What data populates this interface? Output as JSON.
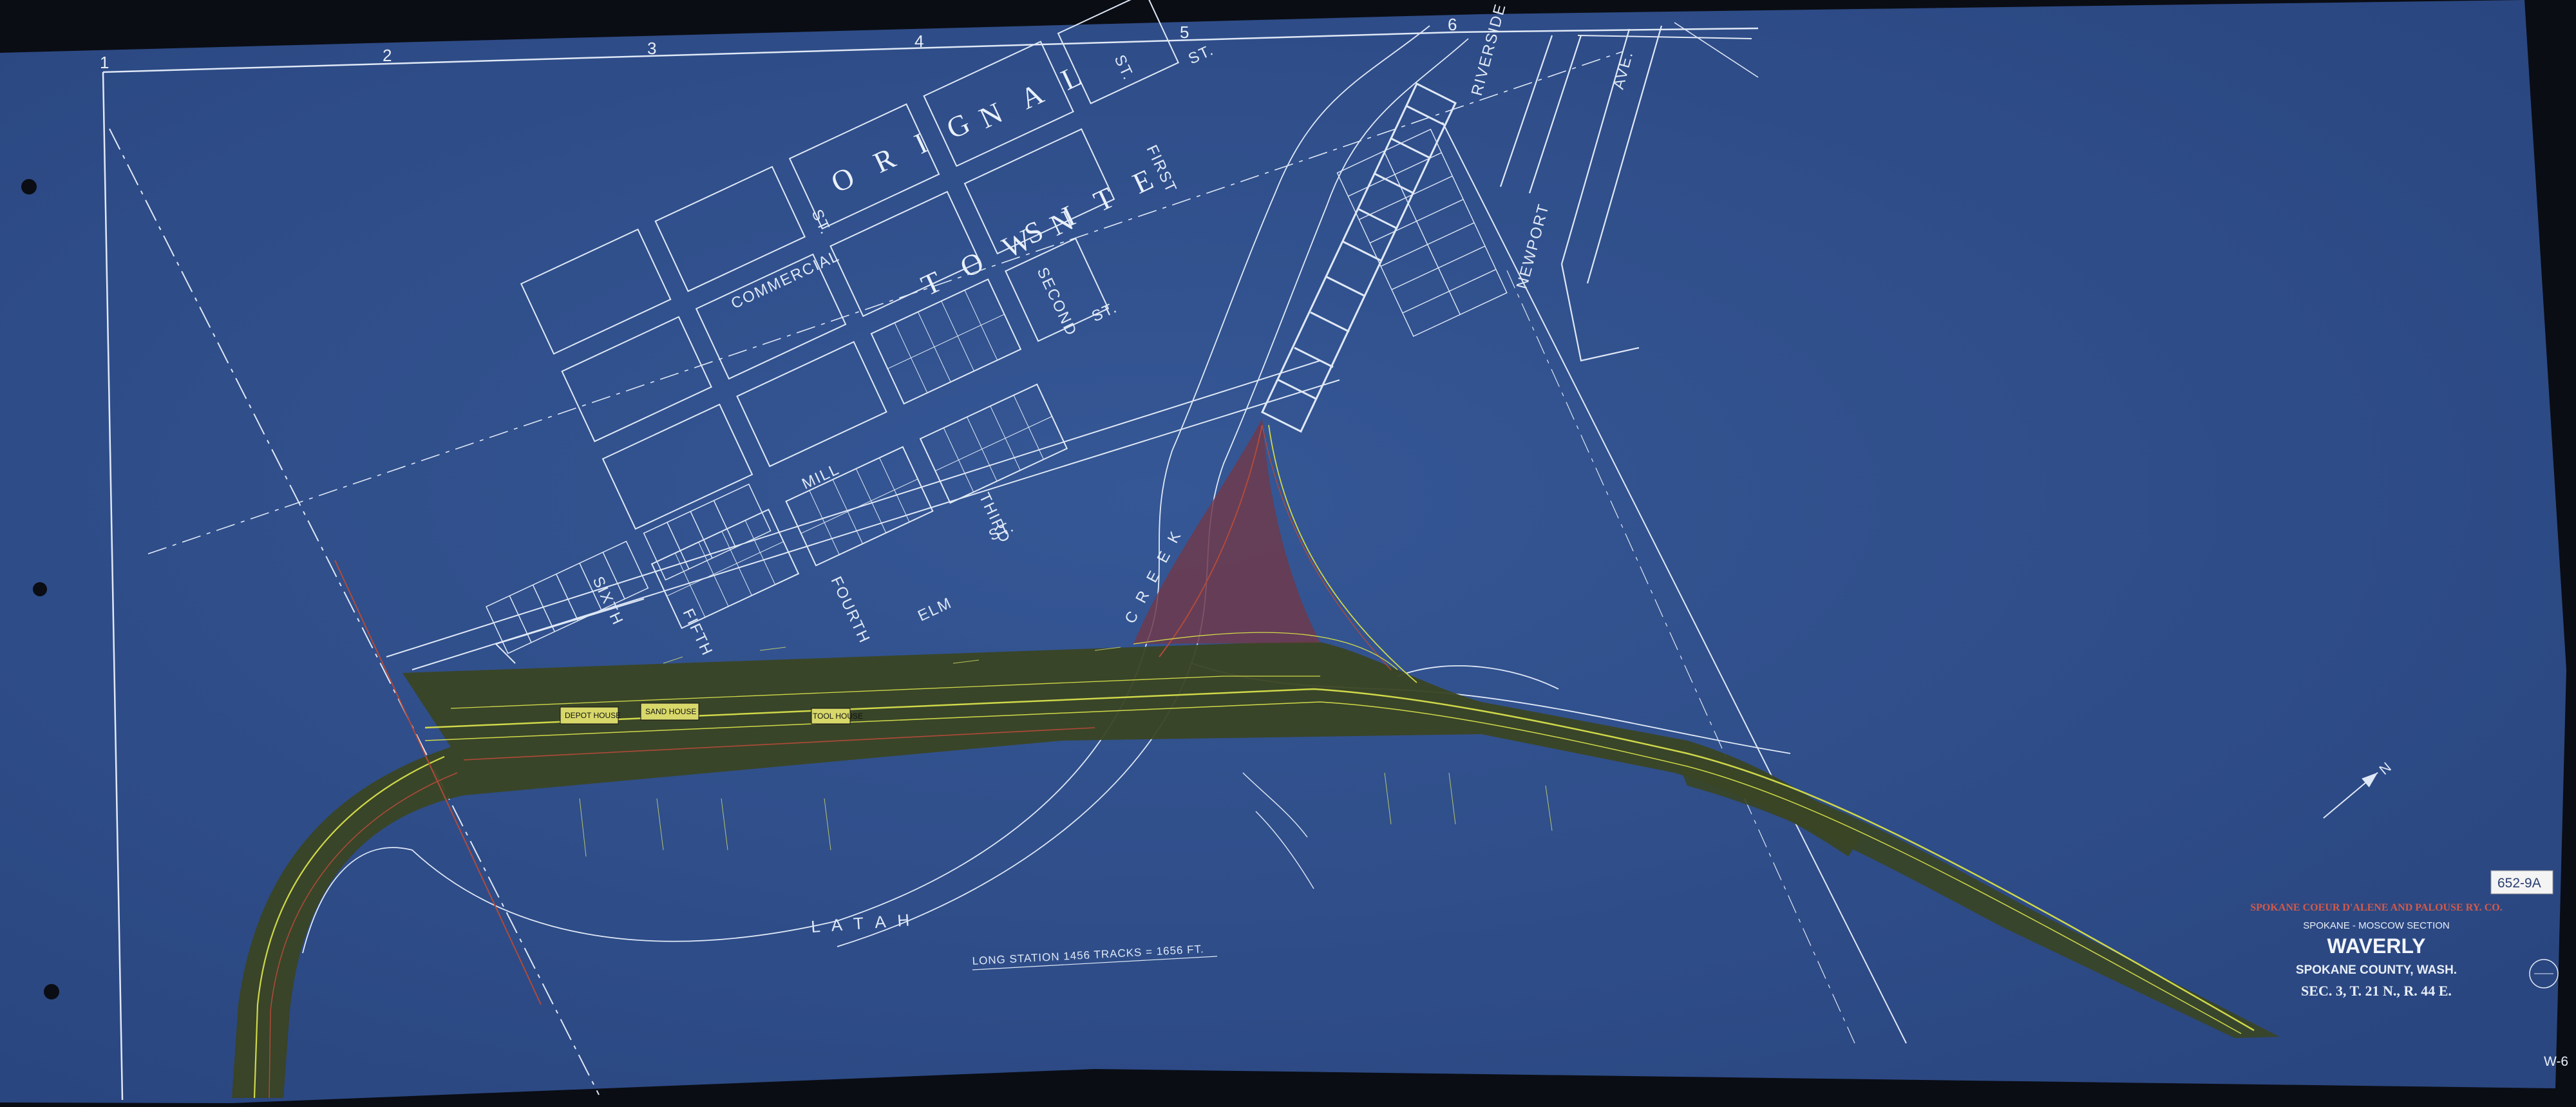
{
  "grid_labels": [
    "1",
    "2",
    "3",
    "4",
    "5",
    "6"
  ],
  "town_name": "O R I G I N A L     T O W N S I T E",
  "town_parts": [
    "O R I G",
    "N A L",
    "T O W N",
    "S I T E"
  ],
  "streets": {
    "commercial": "COMMERCIAL",
    "mill": "MILL",
    "elm": "ELM",
    "st": "ST.",
    "first": "FIRST",
    "second": "SECOND",
    "third": "THIRD",
    "fourth": "FOURTH",
    "fifth": "FIFTH",
    "sixth": "SIXTH",
    "riverside": "RIVERSIDE",
    "newport": "NEWPORT",
    "ave": "AVE."
  },
  "creek": {
    "latah": "L A T A H",
    "creek": "C R E E K"
  },
  "buildings": [
    "DEPOT HOUSE",
    "SAND HOUSE",
    "TOOL HOUSE"
  ],
  "long_station": "LONG STATION 1456 TRACKS = 1656 FT.",
  "title_block": {
    "company": "SPOKANE COEUR D'ALENE AND PALOUSE RY. CO.",
    "section": "SPOKANE - MOSCOW SECTION",
    "station": "WAVERLY",
    "county": "SPOKANE COUNTY, WASH.",
    "legal": "SEC. 3, T. 21 N., R. 44 E."
  },
  "sheet_tag": "652-9A",
  "sheet_number": "W-6",
  "north_label": "N",
  "colors": {
    "blueprint": "#2f4f8a",
    "lines": "#dfe8f6",
    "railyard": "#3a4523",
    "track_yellow": "#cfd84a",
    "track_red": "#b04a3a",
    "triangle_red": "#6f3a4c"
  }
}
